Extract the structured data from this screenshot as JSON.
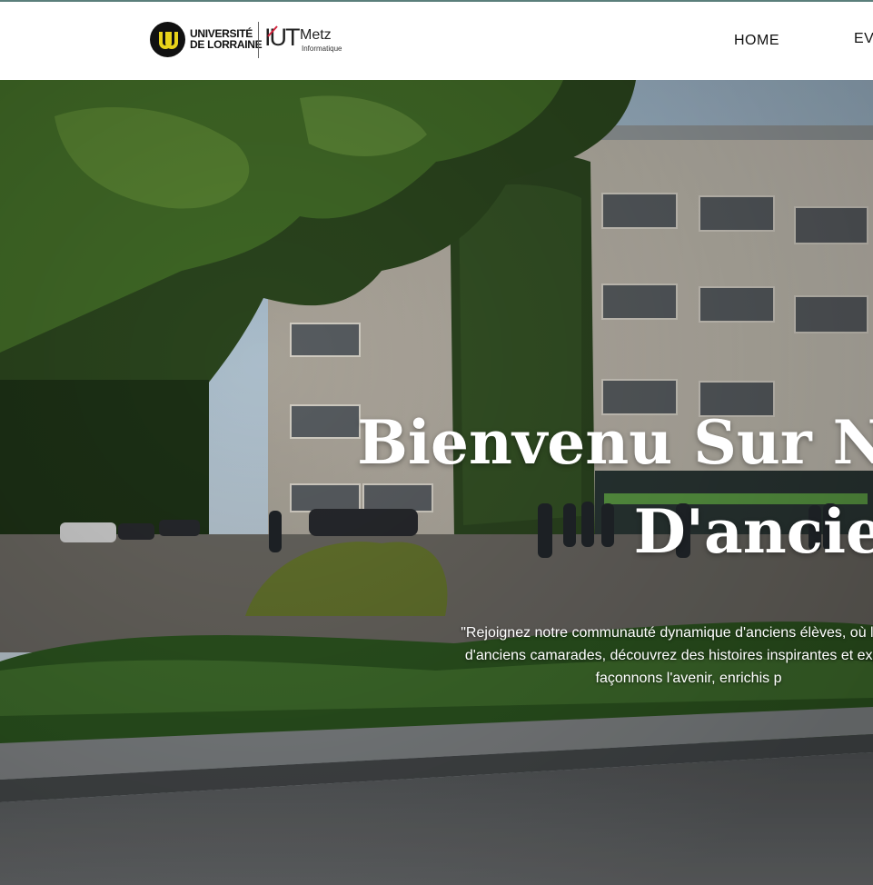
{
  "brand": {
    "university_line1": "UNIVERSITÉ",
    "university_line2": "DE LORRAINE",
    "iut": "IUT",
    "city": "Metz",
    "department": "Informatique"
  },
  "nav": {
    "items": [
      "HOME",
      "EV"
    ]
  },
  "hero": {
    "title_line1": "Bienvenu Sur No",
    "title_line2": "D'ancien",
    "description_line1": "\"Rejoignez notre communauté dynamique d'anciens élèves, où les sou",
    "description_line2": "d'anciens camarades, découvrez des histoires inspirantes et explorez",
    "description_line3": "façonnons l'avenir, enrichis p"
  },
  "colors": {
    "top_accent": "#5b7f7b",
    "nav_text": "#111111",
    "hero_text": "#ffffff"
  }
}
